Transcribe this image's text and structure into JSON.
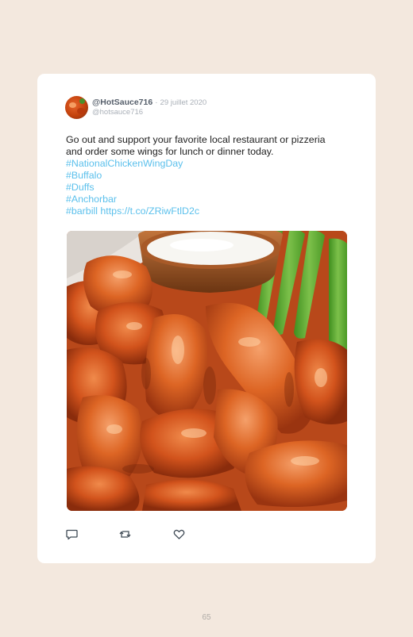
{
  "tweet": {
    "username": "@HotSauce716",
    "separator": "·",
    "date": "29 juillet 2020",
    "handle": "@hotsauce716",
    "text_line1": "Go out and support your favorite local restaurant or pizzeria",
    "text_line2": "and order some wings for lunch or dinner today.",
    "hashtags": [
      "#NationalChickenWingDay",
      "#Buffalo",
      "#Duffs",
      "#Anchorbar",
      "#barbill"
    ],
    "link": "https://t.co/ZRiwFtlD2c",
    "link_color": "#5bc0ec"
  },
  "icons": {
    "avatar": "chicken-wings-avatar",
    "reply": "reply-icon",
    "retweet": "retweet-icon",
    "like": "heart-icon"
  },
  "colors": {
    "page_background": "#f3e8de",
    "card_background": "#ffffff",
    "username": "#565f6b",
    "meta": "#aab0b8"
  },
  "page_number": "65"
}
